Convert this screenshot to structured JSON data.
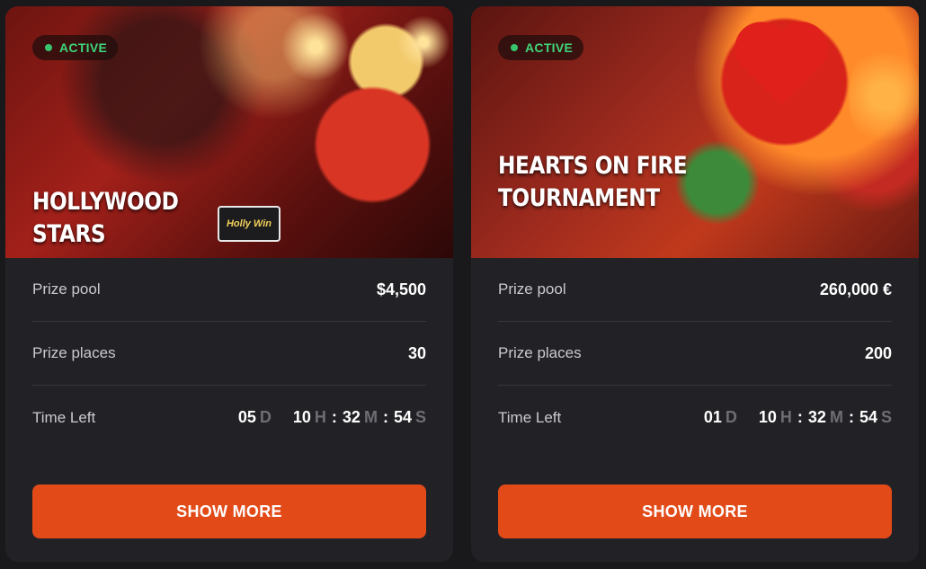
{
  "tournaments": [
    {
      "status": "ACTIVE",
      "title": "HOLLYWOOD STARS",
      "logo_text": "Holly Win",
      "prize_pool_label": "Prize pool",
      "prize_pool_value": "$4,500",
      "prize_places_label": "Prize places",
      "prize_places_value": "30",
      "time_left_label": "Time Left",
      "timer": {
        "days": "05",
        "d": "D",
        "hours": "10",
        "h": "H",
        "minutes": "32",
        "m": "M",
        "seconds": "54",
        "s": "S"
      },
      "button_label": "SHOW MORE"
    },
    {
      "status": "ACTIVE",
      "title": "HEARTS ON FIRE TOURNAMENT",
      "prize_pool_label": "Prize pool",
      "prize_pool_value": "260,000 €",
      "prize_places_label": "Prize places",
      "prize_places_value": "200",
      "time_left_label": "Time Left",
      "timer": {
        "days": "01",
        "d": "D",
        "hours": "10",
        "h": "H",
        "minutes": "32",
        "m": "M",
        "seconds": "54",
        "s": "S"
      },
      "button_label": "SHOW MORE"
    }
  ],
  "colors": {
    "page_bg": "#19191c",
    "card_bg": "#222226",
    "accent": "#e24a18",
    "active_green": "#3fd57a"
  }
}
